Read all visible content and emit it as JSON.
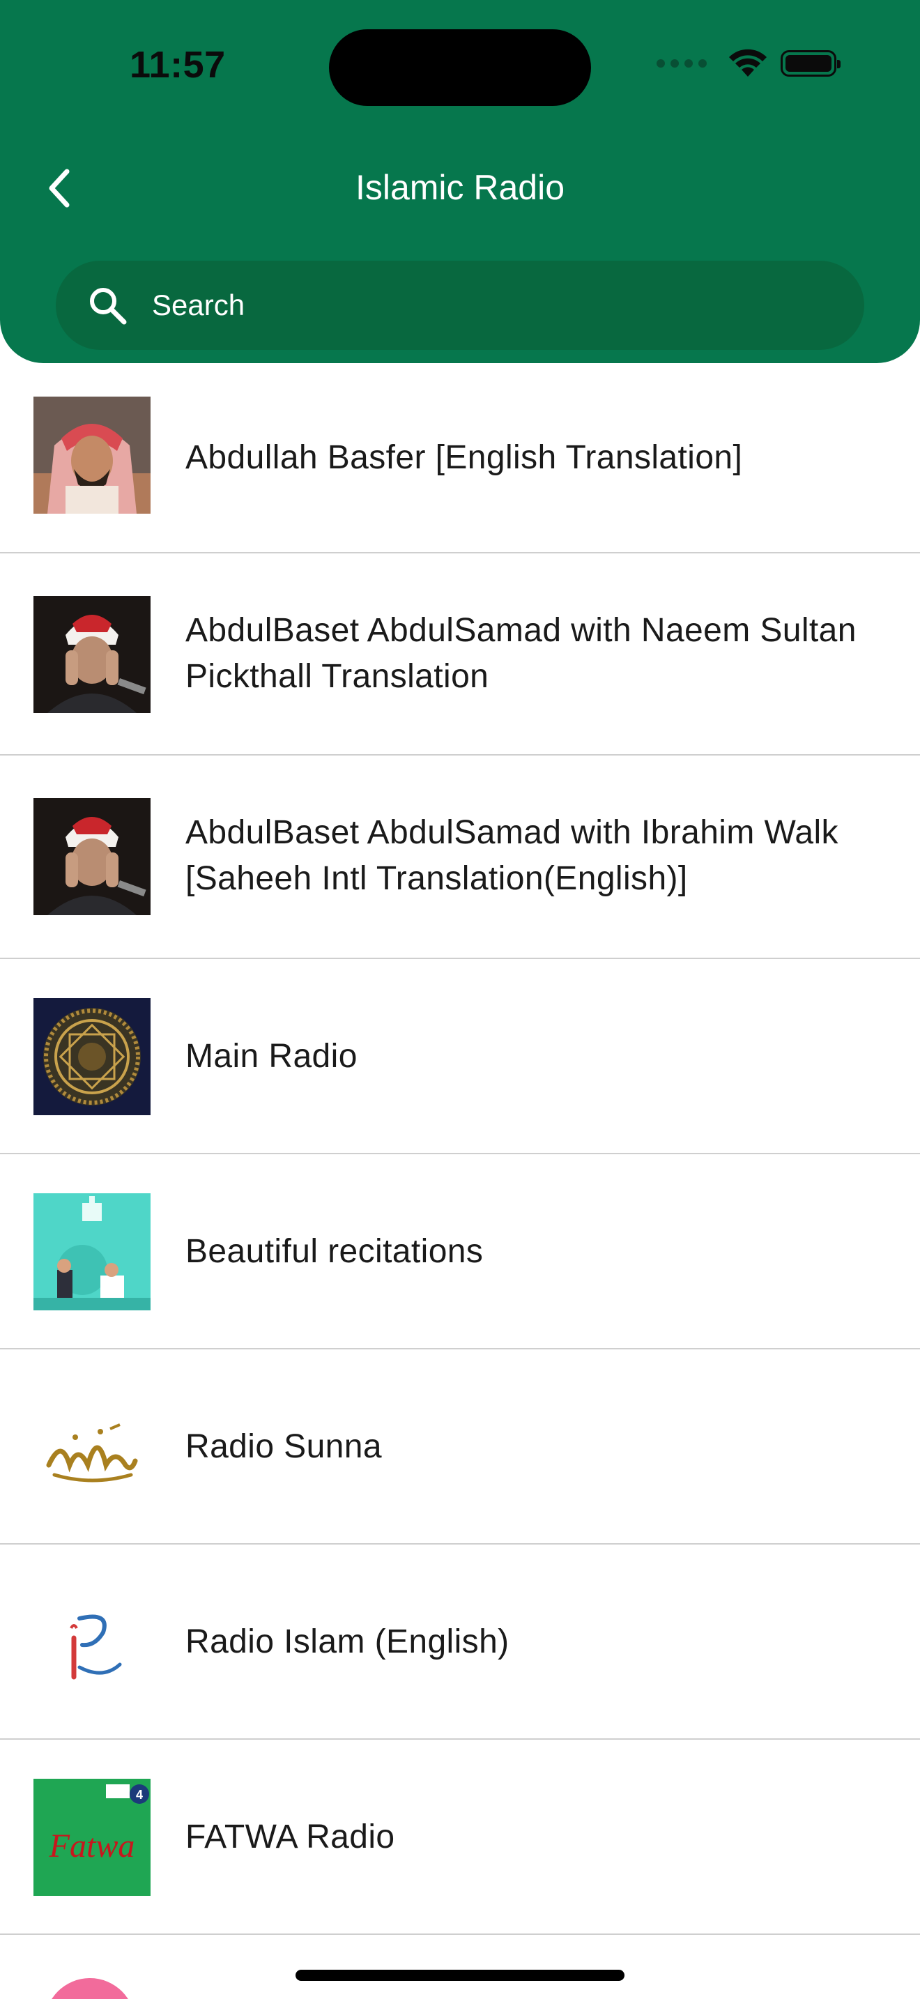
{
  "status_bar": {
    "time": "11:57"
  },
  "nav": {
    "title": "Islamic Radio",
    "back_icon": "chevron-left-icon"
  },
  "search": {
    "placeholder": "Search",
    "icon": "search-icon"
  },
  "stations": [
    {
      "title": "Abdullah Basfer [English Translation]",
      "thumb": "reciter-photo-red-headdress"
    },
    {
      "title": "AbdulBaset AbdulSamad with Naeem Sultan Pickthall Translation",
      "thumb": "reciter-photo-abdulbaset"
    },
    {
      "title": "AbdulBaset AbdulSamad with Ibrahim Walk [Saheeh Intl Translation(English)]",
      "thumb": "reciter-photo-abdulbaset"
    },
    {
      "title": "Main Radio",
      "thumb": "quran-calligraphy-emblem"
    },
    {
      "title": "Beautiful recitations",
      "thumb": "teal-illustration-mosque"
    },
    {
      "title": "Radio Sunna",
      "thumb": "arabic-calligraphy-sunna"
    },
    {
      "title": "Radio Islam (English)",
      "thumb": "radio-islam-logo"
    },
    {
      "title": "FATWA Radio",
      "thumb": "fatwa-green-logo"
    }
  ],
  "thumb_labels": {
    "fatwa": "Fatwa",
    "bbc": "4"
  },
  "colors": {
    "header_green": "#06774d",
    "search_green": "#08683f",
    "divider": "#cfcfcf"
  }
}
